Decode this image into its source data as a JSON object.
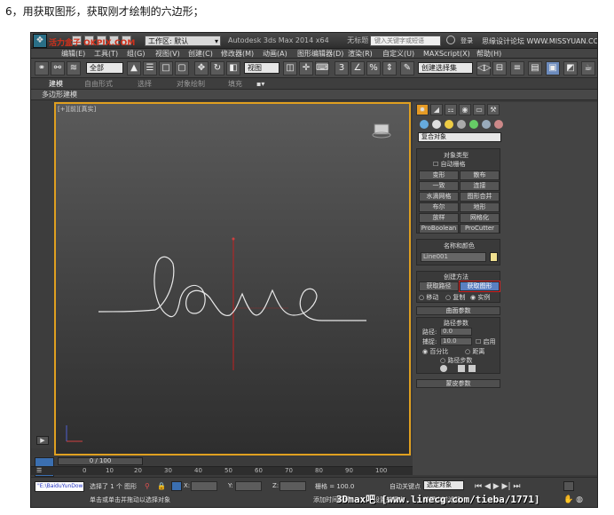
{
  "caption": "6，用获取图形，获取刚才绘制的六边形；",
  "titlebar": {
    "logo": "❖",
    "workspace": "工作区: 默认",
    "title": "Autodesk 3ds Max 2014 x64",
    "file": "无标题",
    "search_placeholder": "键入关键字或短语",
    "user": "登录",
    "watermark_left": "活力盒子 OKPIX.COM",
    "watermark_right": "思缘设计论坛 WWW.MISSYUAN.COM"
  },
  "menu": [
    "编辑(E)",
    "工具(T)",
    "组(G)",
    "视图(V)",
    "创建(C)",
    "修改器(M)",
    "动画(A)",
    "图形编辑器(D)",
    "渲染(R)",
    "自定义(U)",
    "MAXScript(X)",
    "帮助(H)"
  ],
  "toolbar": {
    "filter": "全部",
    "refsys": "视图",
    "selset": "创建选择集"
  },
  "ribbon": {
    "tabs": [
      "建模",
      "自由形式",
      "选择",
      "对象绘制",
      "填充"
    ],
    "sub": "多边形建模"
  },
  "viewport": {
    "label": "[+][前][真实]",
    "sketch_text": "love"
  },
  "panel": {
    "category": "复合对象",
    "object_type": {
      "header": "对象类型",
      "autogrid": "自动栅格",
      "buttons": [
        "变形",
        "散布",
        "一致",
        "连接",
        "水滴网格",
        "图形合并",
        "布尔",
        "地形",
        "放样",
        "网格化",
        "ProBoolean",
        "ProCutter"
      ]
    },
    "name_color": {
      "header": "名称和颜色",
      "name": "Line001"
    },
    "create_method": {
      "header": "创建方法",
      "get_path": "获取路径",
      "get_shape": "获取图形",
      "move": "移动",
      "copy": "复制",
      "instance": "实例"
    },
    "surface": "曲面参数",
    "path_params": {
      "header": "路径参数",
      "path_label": "路径:",
      "path_value": "0.0",
      "snap_label": "捕捉:",
      "snap_value": "10.0",
      "enable": "启用",
      "percent": "百分比",
      "distance": "距离",
      "steps": "路径步数"
    },
    "skin": "蒙皮参数"
  },
  "timeline": {
    "frame": "0 / 100",
    "ticks": [
      "0",
      "10",
      "20",
      "30",
      "40",
      "50",
      "60",
      "70",
      "80",
      "90",
      "100"
    ]
  },
  "status": {
    "selected": "选择了 1 个 图形",
    "prompt": "单击或单击并拖动以选择对象",
    "x": "X:",
    "y": "Y:",
    "z": "Z:",
    "grid": "栅格 = 100.0",
    "autokey": "自动关键点",
    "setkey": "设置关键点",
    "selobj": "选定对象",
    "addtime": "添加时间标记",
    "kf": "关键点过滤器...",
    "tieba": "\"E:\\BaiduYunDow",
    "watermark": "3Dmax吧 [www.linecg.com/tieba/1771]"
  }
}
